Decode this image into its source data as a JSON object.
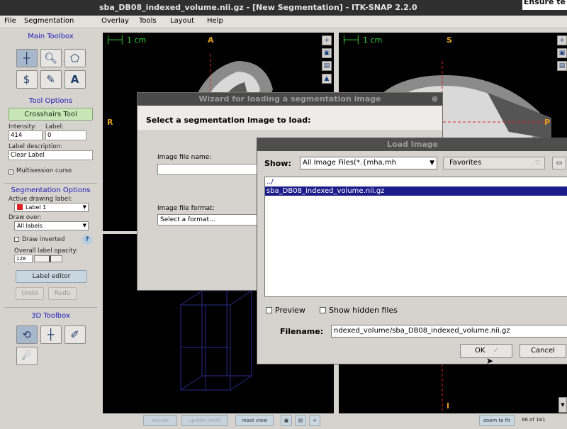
{
  "window": {
    "title": "sba_DB08_indexed_volume.nii.gz - [New Segmentation] - ITK-SNAP 2.2.0",
    "corner_text": "Ensure te"
  },
  "menu": [
    "File",
    "Segmentation",
    "Overlay",
    "Tools",
    "Layout",
    "Help"
  ],
  "toolbox": {
    "main_header": "Main Toolbox",
    "tool_options_header": "Tool Options",
    "tool_button": "Crosshairs Tool",
    "intensity_label": "Intensity:",
    "intensity_value": "414",
    "label_label": "Label:",
    "label_value": "0",
    "label_desc_label": "Label description:",
    "label_desc_value": "Clear Label",
    "multisession": "Multisession curso",
    "seg_options_header": "Segmentation Options",
    "active_label_caption": "Active drawing label:",
    "active_label_value": "Label 1",
    "draw_over_caption": "Draw over:",
    "draw_over_value": "All labels",
    "draw_inverted": "Draw inverted",
    "opacity_caption": "Overall label opacity:",
    "opacity_value": "128",
    "label_editor": "Label editor",
    "undo": "Undo",
    "redo": "Redo",
    "toolbox3d_header": "3D Toolbox"
  },
  "viewers": {
    "scale_text": "1 cm",
    "axial": {
      "top": "A",
      "left": "R"
    },
    "sagittal": {
      "top": "S",
      "right": "P",
      "bottom": "I"
    }
  },
  "bottom_bar": {
    "accept": "accept",
    "update_mesh": "update mesh",
    "reset_view": "reset view",
    "zoom_to_fit": "zoom to fit",
    "slice_counter": "86 of 181"
  },
  "wizard": {
    "title": "Wizard for loading a segmentation image",
    "heading": "Select a segmentation image to load:",
    "file_name_label": "Image file name:",
    "file_format_label": "Image file format:",
    "file_format_value": "Select a format..."
  },
  "load_image": {
    "title": "Load Image",
    "show_label": "Show:",
    "filter_value": "All Image Files(*.{mha,mh",
    "favorites": "Favorites",
    "files": [
      "../",
      "sba_DB08_indexed_volume.nii.gz"
    ],
    "selected_index": 1,
    "preview": "Preview",
    "show_hidden": "Show hidden files",
    "filename_label": "Filename:",
    "filename_value": "ndexed_volume/sba_DB08_indexed_volume.nii.gz",
    "ok": "OK",
    "cancel": "Cancel"
  },
  "colors": {
    "label1": "#e02020",
    "selection": "#1c1c8a",
    "scale_green": "#36d636",
    "orientation": "#e0a020"
  }
}
